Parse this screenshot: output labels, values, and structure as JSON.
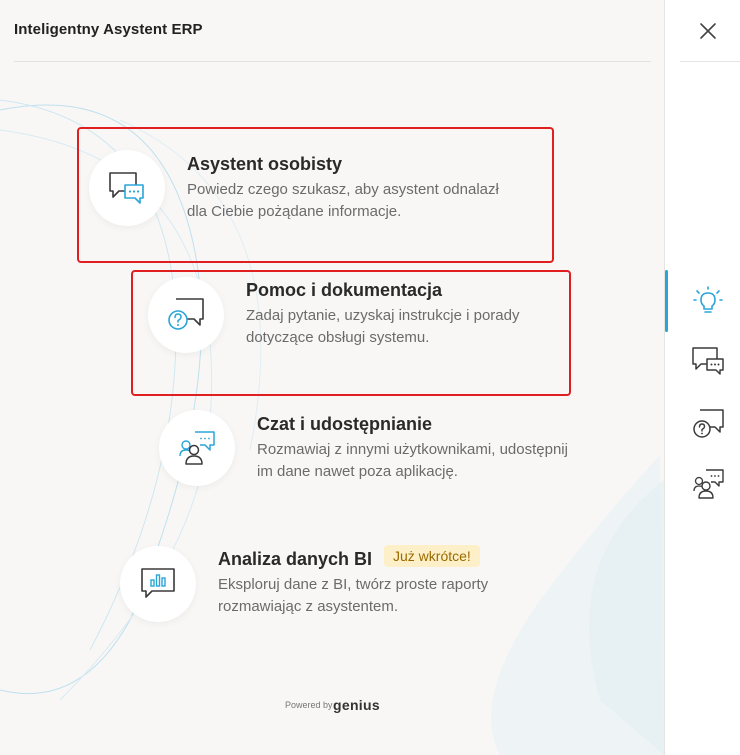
{
  "header": {
    "title": "Inteligentny Asystent ERP"
  },
  "items": [
    {
      "title": "Asystent osobisty",
      "desc_line1": "Powiedz czego szukasz, aby asystent odnalazł",
      "desc_line2": "dla Ciebie pożądane informacje."
    },
    {
      "title": "Pomoc i dokumentacja",
      "desc_line1": "Zadaj pytanie, uzyskaj instrukcje i porady",
      "desc_line2": "dotyczące obsługi systemu."
    },
    {
      "title": "Czat i udostępnianie",
      "desc_line1": "Rozmawiaj z innymi użytkownikami, udostępnij",
      "desc_line2": "im dane nawet poza aplikację."
    },
    {
      "title": "Analiza danych BI",
      "badge": "Już wkrótce!",
      "desc_line1": "Eksploruj dane z BI, twórz proste raporty",
      "desc_line2": "rozmawiając z asystentem."
    }
  ],
  "footer": {
    "powered_by": "Powered by",
    "brand": "genius"
  },
  "sidebar": {
    "icons": [
      "lightbulb-icon",
      "chat-bubble-icon",
      "help-question-icon",
      "chat-users-icon"
    ],
    "active_index": 0
  },
  "colors": {
    "accent": "#2aa5d8",
    "highlight": "#e02020",
    "badge_bg": "#fdf0c8",
    "icon_stroke": "#3a3a3a"
  }
}
